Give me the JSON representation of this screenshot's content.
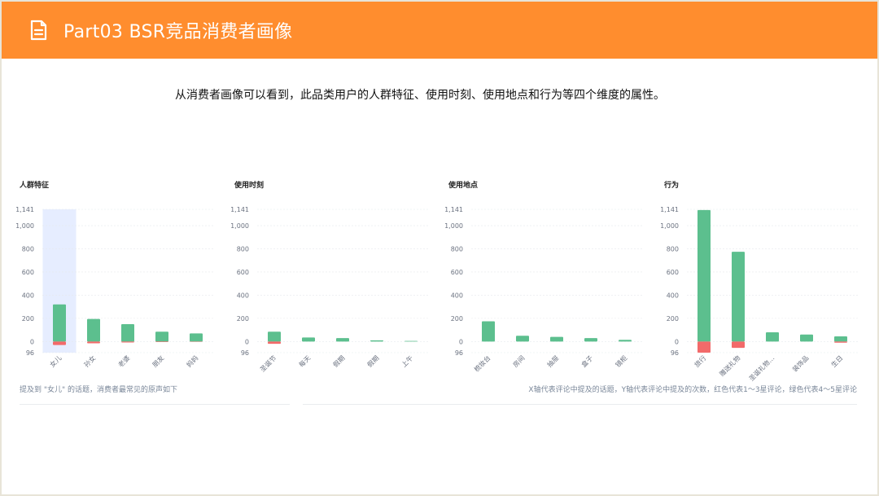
{
  "header": {
    "title": "Part03 BSR竞品消费者画像"
  },
  "intro": "从消费者画像可以看到，此品类用户的人群特征、使用时刻、使用地点和行为等四个维度的属性。",
  "colors": {
    "header": "#ff8d2e",
    "positive": "#5cbf8e",
    "negative": "#f26a6a",
    "highlight": "#e6edff"
  },
  "chart_data": [
    {
      "type": "bar",
      "title": "人群特征",
      "categories": [
        "女儿",
        "孙女",
        "老婆",
        "朋友",
        "妈妈"
      ],
      "series": [
        {
          "values": [
            320,
            195,
            150,
            85,
            70
          ]
        },
        {
          "values": [
            -30,
            -15,
            -8,
            -5,
            -3
          ]
        }
      ],
      "ylim": [
        -96,
        1141
      ],
      "yticks": [
        "1,141",
        "1,000",
        "800",
        "600",
        "400",
        "200",
        "0",
        "96"
      ],
      "highlight": "女儿"
    },
    {
      "type": "bar",
      "title": "使用时刻",
      "categories": [
        "圣诞节",
        "每天",
        "假期",
        "假期",
        "上午"
      ],
      "series": [
        {
          "values": [
            85,
            35,
            30,
            10,
            5
          ]
        },
        {
          "values": [
            -20,
            0,
            0,
            0,
            0
          ]
        }
      ],
      "ylim": [
        -96,
        1141
      ],
      "yticks": [
        "1,141",
        "1,000",
        "800",
        "600",
        "400",
        "200",
        "0",
        "96"
      ]
    },
    {
      "type": "bar",
      "title": "使用地点",
      "categories": [
        "梳妆台",
        "房间",
        "抽屉",
        "盒子",
        "镜柜"
      ],
      "series": [
        {
          "values": [
            175,
            50,
            40,
            30,
            15
          ]
        },
        {
          "values": [
            0,
            0,
            0,
            0,
            0
          ]
        }
      ],
      "ylim": [
        -96,
        1141
      ],
      "yticks": [
        "1,141",
        "1,000",
        "800",
        "600",
        "400",
        "200",
        "0",
        "96"
      ]
    },
    {
      "type": "bar",
      "title": "行为",
      "categories": [
        "旅行",
        "赠送礼物",
        "圣诞礼物…",
        "装饰品",
        "生日"
      ],
      "series": [
        {
          "values": [
            1135,
            775,
            80,
            60,
            45
          ]
        },
        {
          "values": [
            -96,
            -55,
            0,
            0,
            -10
          ]
        }
      ],
      "ylim": [
        -96,
        1141
      ],
      "yticks": [
        "1,141",
        "1,000",
        "800",
        "600",
        "400",
        "200",
        "0",
        "96"
      ]
    }
  ],
  "footnote_left": "提及到 \"女儿\" 的话题，消费者最常见的原声如下",
  "footnote_right": "X轴代表评论中提及的话题，Y轴代表评论中提及的次数，红色代表1～3星评论，绿色代表4～5星评论"
}
